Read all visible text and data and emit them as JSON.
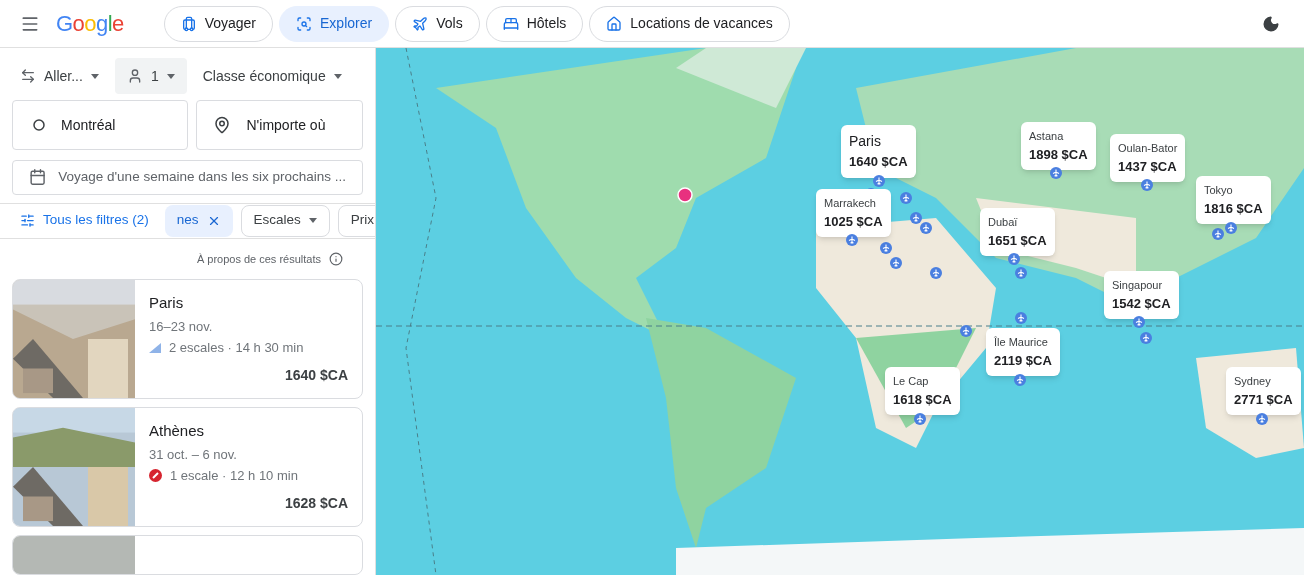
{
  "header": {
    "logo": "Google",
    "nav": [
      {
        "label": "Voyager",
        "selected": false
      },
      {
        "label": "Explorer",
        "selected": true
      },
      {
        "label": "Vols",
        "selected": false
      },
      {
        "label": "Hôtels",
        "selected": false
      },
      {
        "label": "Locations de vacances",
        "selected": false
      }
    ]
  },
  "search": {
    "trip_type": "Aller...",
    "passengers": "1",
    "cabin": "Classe économique",
    "origin": "Montréal",
    "destination": "N'importe où",
    "dates": "Voyage d'une semaine dans les six prochains ..."
  },
  "filters": {
    "all_filters": "Tous les filtres (2)",
    "chips": [
      {
        "label": "nes",
        "selected": true,
        "kind": "removable"
      },
      {
        "label": "Escales",
        "selected": false,
        "kind": "dropdown"
      },
      {
        "label": "Prix",
        "selected": false,
        "kind": "plain"
      }
    ]
  },
  "about": "À propos de ces résultats",
  "results": [
    {
      "city": "Paris",
      "dates": "16–23 nov.",
      "details": "2 escales · 14 h 30 min",
      "price": "1640 $CA"
    },
    {
      "city": "Athènes",
      "dates": "31 oct. – 6 nov.",
      "details": "1 escale · 12 h 10 min",
      "price": "1628 $CA"
    }
  ],
  "map_callouts": [
    {
      "city": "Paris",
      "price": "1640 $CA",
      "selected": true
    },
    {
      "city": "Marrakech",
      "price": "1025 $CA",
      "selected": false
    },
    {
      "city": "Astana",
      "price": "1898 $CA",
      "selected": false
    },
    {
      "city": "Oulan-Bator",
      "price": "1437 $CA",
      "selected": false
    },
    {
      "city": "Tokyo",
      "price": "1816 $CA",
      "selected": false
    },
    {
      "city": "Dubaï",
      "price": "1651 $CA",
      "selected": false
    },
    {
      "city": "Singapour",
      "price": "1542 $CA",
      "selected": false
    },
    {
      "city": "Île Maurice",
      "price": "2119 $CA",
      "selected": false
    },
    {
      "city": "Le Cap",
      "price": "1618 $CA",
      "selected": false
    },
    {
      "city": "Sydney",
      "price": "2771 $CA",
      "selected": false
    }
  ]
}
